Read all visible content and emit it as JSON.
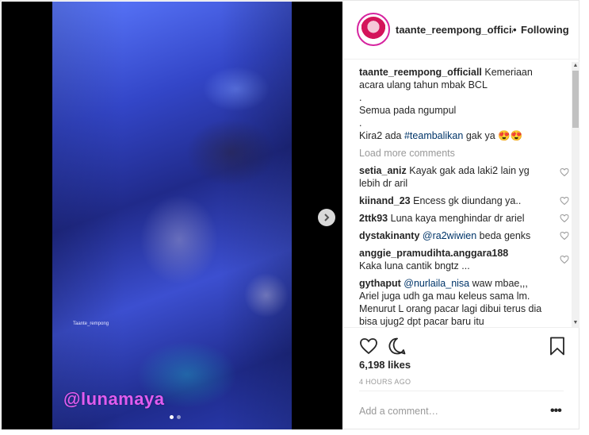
{
  "post": {
    "author": "taante_reempong_officiall",
    "follow_sep": "•",
    "follow_label": "Following",
    "media": {
      "watermark": "Taante_rempong",
      "overlay_tag": "@lunamaya"
    },
    "caption": {
      "user": "taante_reempong_officiall",
      "lines": [
        "Kemeriaan",
        "acara ulang tahun mbak BCL",
        ".",
        "Semua pada ngumpul",
        ".",
        "Kira2 ada ",
        "#teambalikan",
        " gak ya 😍😍"
      ]
    },
    "load_more": "Load more comments",
    "comments": [
      {
        "user": "setia_aniz",
        "text": "Kayak gak ada laki2 lain yg lebih dr aril"
      },
      {
        "user": "kiinand_23",
        "text": "Encess gk diundang ya.."
      },
      {
        "user": "2ttk93",
        "text": "Luna kaya menghindar dr ariel"
      },
      {
        "user": "dystakinanty",
        "mention": "@ra2wiwien",
        "text": "beda genks"
      },
      {
        "user": "anggie_pramudihta.anggara188",
        "text": "Kaka luna cantik bngtz ..."
      },
      {
        "user": "gythaput",
        "mention": "@nurlaila_nisa",
        "text": "waw mbae,,, Ariel juga udh ga mau keleus sama lm. Menurut L orang pacar lagi dibui terus dia bisa ujug2 dpt pacar baru itu"
      }
    ],
    "likes": "6,198 likes",
    "time_ago": "4 HOURS AGO",
    "add_comment_placeholder": "Add a comment…",
    "more_icon": "•••"
  },
  "scroll": {
    "up": "▲",
    "down": "▼"
  },
  "colors": {
    "link": "#003569",
    "muted": "#999999",
    "text": "#262626",
    "avatar_ring": "#d6249f",
    "overlay_tag": "#e05cf0"
  },
  "icons": [
    "chevron-right-icon",
    "heart-icon",
    "comment-icon",
    "bookmark-icon",
    "more-icon"
  ]
}
